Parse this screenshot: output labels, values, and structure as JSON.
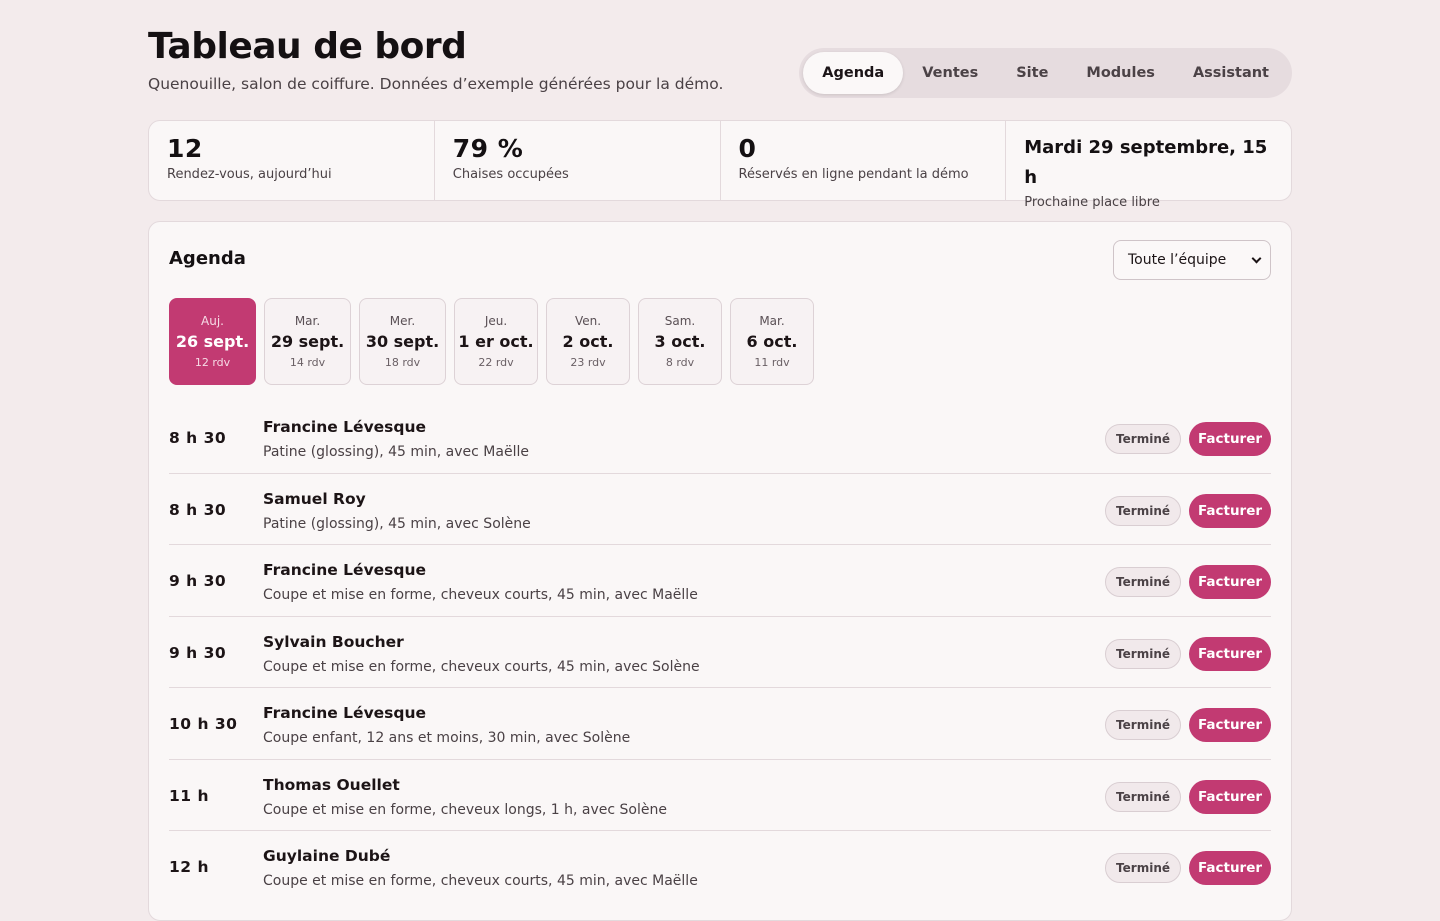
{
  "header": {
    "title": "Tableau de bord",
    "subtitle": "Quenouille, salon de coiffure. Données d’exemple générées pour la démo."
  },
  "tabs": [
    {
      "label": "Agenda",
      "active": true
    },
    {
      "label": "Ventes",
      "active": false
    },
    {
      "label": "Site",
      "active": false
    },
    {
      "label": "Modules",
      "active": false
    },
    {
      "label": "Assistant",
      "active": false
    }
  ],
  "stats": [
    {
      "value": "12",
      "label": "Rendez-vous, aujourd’hui"
    },
    {
      "value": "79 %",
      "label": "Chaises occupées"
    },
    {
      "value": "0",
      "label": "Réservés en ligne pendant la démo"
    },
    {
      "value": "Mardi 29 septembre, 15 h",
      "label": "Prochaine place libre"
    }
  ],
  "agenda": {
    "title": "Agenda",
    "staff_filter": "Toute l’équipe",
    "days": [
      {
        "name": "Auj.",
        "date": "26 sept.",
        "count": "12 rdv",
        "active": true
      },
      {
        "name": "Mar.",
        "date": "29 sept.",
        "count": "14 rdv",
        "active": false
      },
      {
        "name": "Mer.",
        "date": "30 sept.",
        "count": "18 rdv",
        "active": false
      },
      {
        "name": "Jeu.",
        "date": "1 er oct.",
        "count": "22 rdv",
        "active": false
      },
      {
        "name": "Ven.",
        "date": "2 oct.",
        "count": "23 rdv",
        "active": false
      },
      {
        "name": "Sam.",
        "date": "3 oct.",
        "count": "8 rdv",
        "active": false
      },
      {
        "name": "Mar.",
        "date": "6 oct.",
        "count": "11 rdv",
        "active": false
      }
    ],
    "appointments": [
      {
        "time": "8 h 30",
        "client": "Francine Lévesque",
        "detail": "Patine (glossing), 45 min, avec Maëlle",
        "status": "Terminé",
        "action": "Facturer"
      },
      {
        "time": "8 h 30",
        "client": "Samuel Roy",
        "detail": "Patine (glossing), 45 min, avec Solène",
        "status": "Terminé",
        "action": "Facturer"
      },
      {
        "time": "9 h 30",
        "client": "Francine Lévesque",
        "detail": "Coupe et mise en forme, cheveux courts, 45 min, avec Maëlle",
        "status": "Terminé",
        "action": "Facturer"
      },
      {
        "time": "9 h 30",
        "client": "Sylvain Boucher",
        "detail": "Coupe et mise en forme, cheveux courts, 45 min, avec Solène",
        "status": "Terminé",
        "action": "Facturer"
      },
      {
        "time": "10 h 30",
        "client": "Francine Lévesque",
        "detail": "Coupe enfant, 12 ans et moins, 30 min, avec Solène",
        "status": "Terminé",
        "action": "Facturer"
      },
      {
        "time": "11 h",
        "client": "Thomas Ouellet",
        "detail": "Coupe et mise en forme, cheveux longs, 1 h, avec Solène",
        "status": "Terminé",
        "action": "Facturer"
      },
      {
        "time": "12 h",
        "client": "Guylaine Dubé",
        "detail": "Coupe et mise en forme, cheveux courts, 45 min, avec Maëlle",
        "status": "Terminé",
        "action": "Facturer"
      }
    ]
  },
  "colors": {
    "accent": "#c23a72",
    "background": "#f3ebec",
    "card": "#faf7f7"
  }
}
